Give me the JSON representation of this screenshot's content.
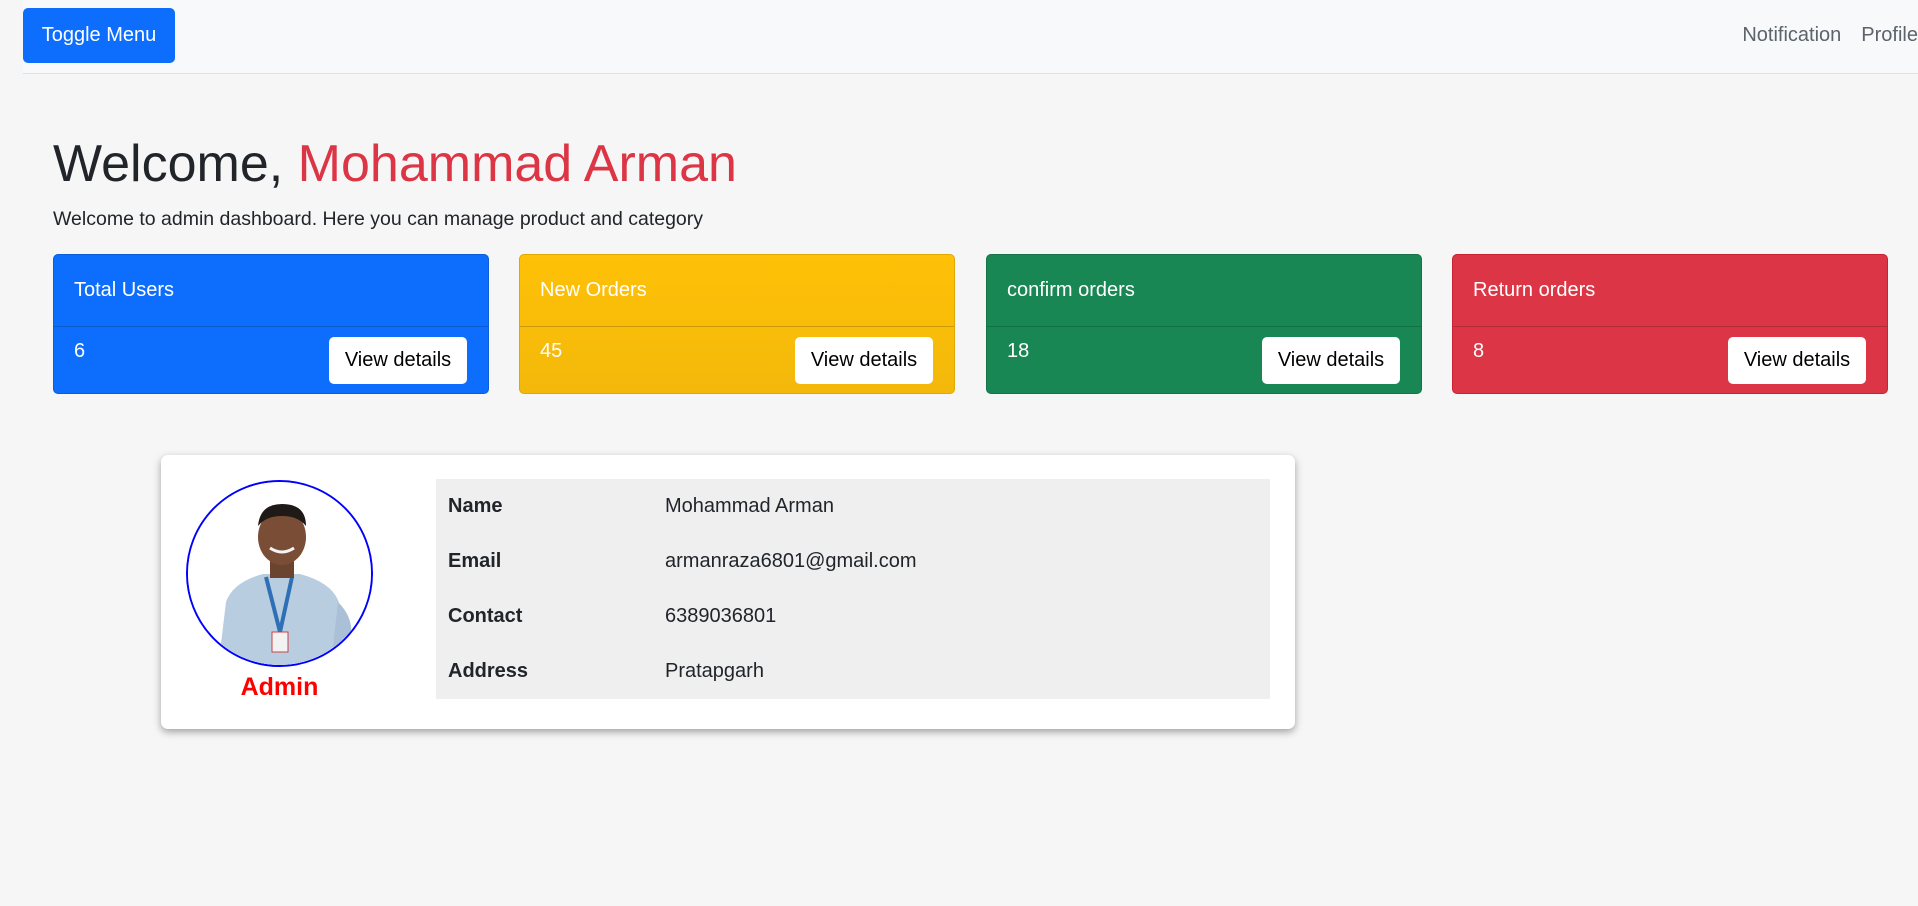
{
  "navbar": {
    "toggle_label": "Toggle Menu",
    "links": [
      "Notification",
      "Profile"
    ]
  },
  "header": {
    "welcome_prefix": "Welcome, ",
    "user_name": "Mohammad Arman",
    "subtitle": "Welcome to admin dashboard. Here you can manage product and category"
  },
  "cards": [
    {
      "title": "Total Users",
      "value": "6",
      "button": "View details",
      "color": "#0d6efd"
    },
    {
      "title": "New Orders",
      "value": "45",
      "button": "View details",
      "color": "#ffc107"
    },
    {
      "title": "confirm orders",
      "value": "18",
      "button": "View details",
      "color": "#198754"
    },
    {
      "title": "Return orders",
      "value": "8",
      "button": "View details",
      "color": "#dc3545"
    }
  ],
  "profile": {
    "role": "Admin",
    "fields": [
      {
        "label": "Name",
        "value": "Mohammad Arman"
      },
      {
        "label": "Email",
        "value": "armanraza6801@gmail.com"
      },
      {
        "label": "Contact",
        "value": "6389036801"
      },
      {
        "label": "Address",
        "value": "Pratapgarh"
      }
    ]
  },
  "colors": {
    "primary": "#0d6efd",
    "warning": "#ffc107",
    "success": "#198754",
    "danger": "#dc3545",
    "role_text": "#ff0000",
    "avatar_border": "#0000ff"
  }
}
